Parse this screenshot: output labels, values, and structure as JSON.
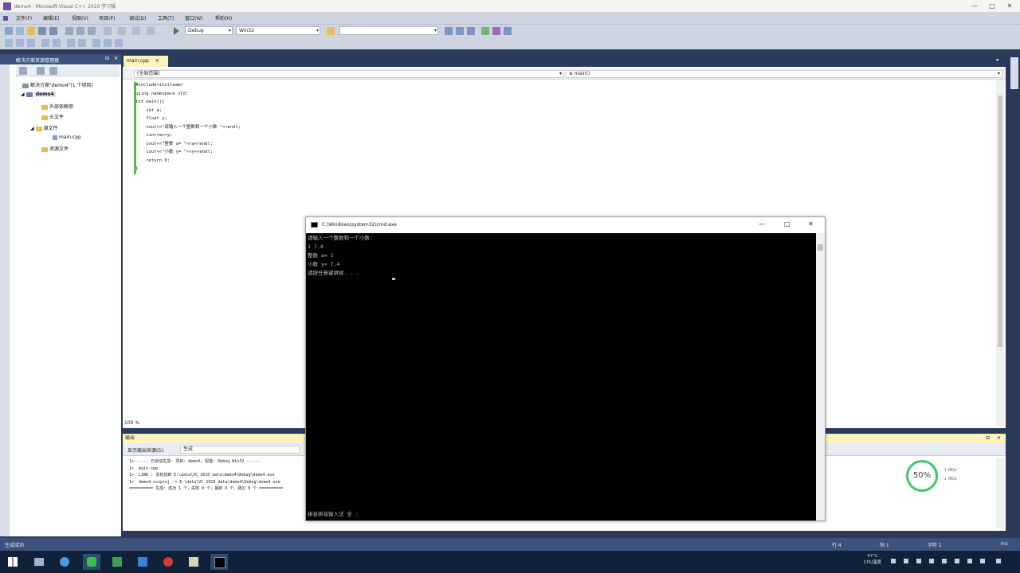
{
  "window": {
    "title": "demo4 - Microsoft Visual C++ 2010 学习版",
    "controls": [
      "—",
      "□",
      "✕"
    ]
  },
  "menu": [
    "文件(F)",
    "编辑(E)",
    "视图(V)",
    "项目(P)",
    "调试(D)",
    "工具(T)",
    "窗口(W)",
    "帮助(H)"
  ],
  "toolbar": {
    "config": "Debug",
    "platform": "Win32"
  },
  "solution_explorer": {
    "title": "解决方案资源管理器",
    "items": [
      {
        "label": "解决方案\"demo4\"(1 个项目)"
      },
      {
        "label": "demo4"
      },
      {
        "label": "外部依赖项"
      },
      {
        "label": "头文件"
      },
      {
        "label": "源文件"
      },
      {
        "label": "main.cpp"
      },
      {
        "label": "资源文件"
      }
    ]
  },
  "editor": {
    "tab": "main.cpp",
    "scope": "(全局范围)",
    "function": "main()",
    "lines": [
      "#include<iostream>",
      "using namespace std;",
      "int main(){",
      "    int a;",
      "    float y;",
      "    cout<<\"请输入一个整数和一个小数 \"<<endl;",
      "    cin>>a>>y;",
      "    cout<<\"整数 a= \"<<a<<endl;",
      "    cout<<\"小数 y= \"<<y<<endl;",
      "    return 0;",
      "}"
    ],
    "zoom": "100 %"
  },
  "output": {
    "title": "输出",
    "source_label": "显示输出来源(S):",
    "source_value": "生成",
    "lines": [
      "1>------ 已启动生成: 项目: demo4, 配置: Debug Win32 ------",
      "1>  main.cpp",
      "1>  LINK : 没有找到 E:\\data\\VC_2010_data\\demo4\\Debug\\demo4.exe",
      "1>  demo4.vcxproj -> E:\\data\\VC_2010_data\\demo4\\Debug\\demo4.exe",
      "========== 生成: 成功 1 个，失败 0 个，最新 0 个，跳过 0 个 =========="
    ]
  },
  "cmd": {
    "title": "C:\\Windows\\system32\\cmd.exe",
    "lines": [
      "请输入一个整数和一个小数:",
      "1 7.4",
      "整数 a= 1",
      "小数 y= 7.4",
      "请按任意键继续. . ."
    ],
    "ime": "拼音拼音输入法 全 :"
  },
  "cpu": {
    "percent": "50%",
    "up": "0K/s",
    "down": "0K/s"
  },
  "status": {
    "left": "生成成功",
    "row": "行 4",
    "col": "列 1",
    "ch": "字符 1",
    "mode": "Ins"
  },
  "taskbar": {
    "temp": "47°C",
    "temp_label": "CPU温度"
  }
}
